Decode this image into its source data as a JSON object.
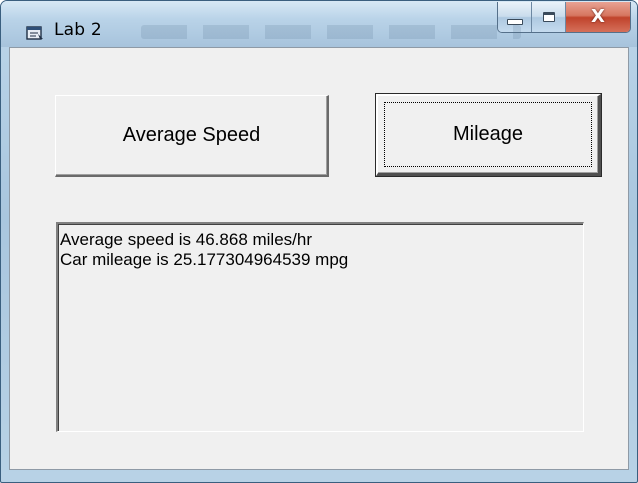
{
  "window": {
    "title": "Lab 2",
    "icon": "form-icon",
    "caption_buttons": {
      "minimize_icon": "minimize-icon",
      "maximize_icon": "maximize-icon",
      "close_icon": "close-icon",
      "close_label": "X"
    }
  },
  "buttons": {
    "average_speed_label": "Average Speed",
    "mileage_label": "Mileage"
  },
  "output": {
    "lines": [
      "Average speed is 46.868 miles/hr",
      "Car mileage is 25.177304964539 mpg"
    ]
  },
  "colors": {
    "window_face": "#f0f0f0",
    "titlebar": "#b9d3e8",
    "close_button": "#c0432c"
  }
}
